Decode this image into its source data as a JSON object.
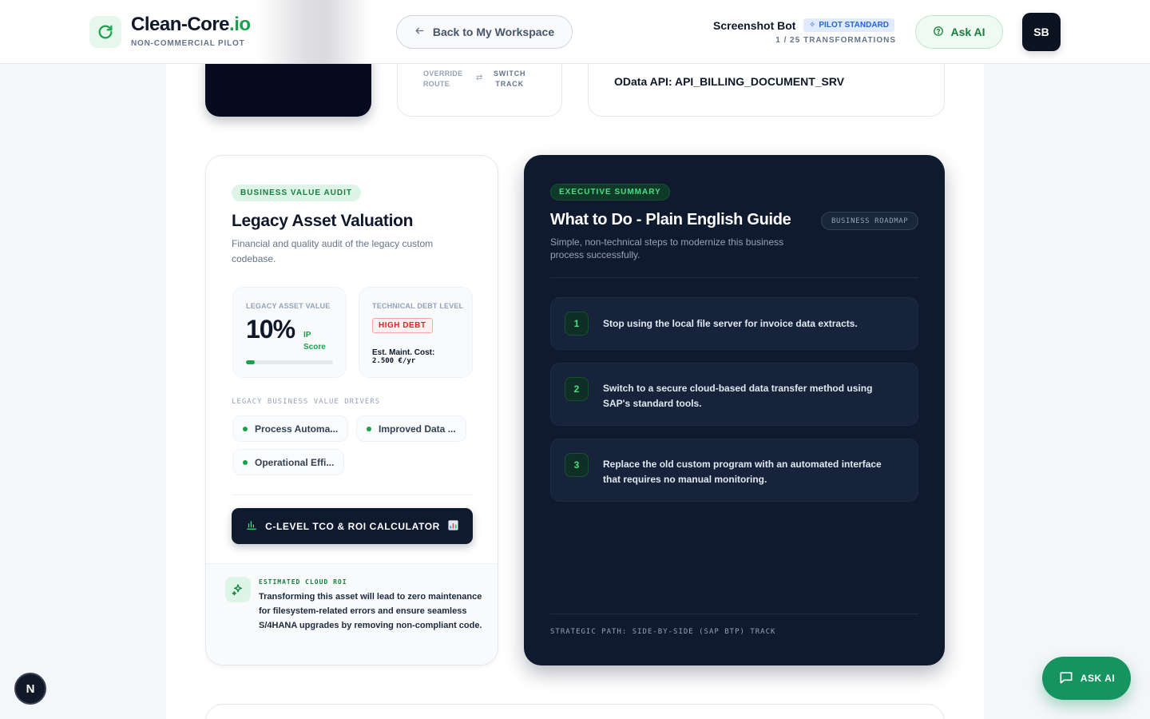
{
  "header": {
    "brand_name": "Clean-Core",
    "brand_tld": ".io",
    "brand_sub": "NON-COMMERCIAL PILOT",
    "back_label": "Back to My Workspace",
    "user_name": "Screenshot Bot",
    "plan_badge": "PILOT STANDARD",
    "transform_count": "1 / 25 TRANSFORMATIONS",
    "ask_ai_label": "Ask AI",
    "avatar_initials": "SB"
  },
  "top_cards": {
    "override_label_line1": "OVERRIDE",
    "override_label_line2": "ROUTE",
    "switch_line1": "SWITCH",
    "switch_line2": "TRACK",
    "target_value": "OData API: API_BILLING_DOCUMENT_SRV"
  },
  "valuation": {
    "tag": "BUSINESS VALUE AUDIT",
    "title": "Legacy Asset Valuation",
    "description": "Financial and quality audit of the legacy custom codebase.",
    "asset_value_label": "LEGACY ASSET VALUE",
    "asset_value": "10%",
    "ip_label": "IP",
    "score_label": "Score",
    "asset_value_fraction": 0.1,
    "debt_label": "TECHNICAL DEBT LEVEL",
    "debt_badge": "HIGH DEBT",
    "maint_label": "Est. Maint. Cost:",
    "maint_value": "2.500 €/yr",
    "drivers_label": "LEGACY BUSINESS VALUE DRIVERS",
    "drivers": [
      "Process Automa...",
      "Improved Data ...",
      "Operational Effi..."
    ],
    "roi_button": "C-LEVEL TCO & ROI CALCULATOR",
    "roi_footer_label": "ESTIMATED CLOUD ROI",
    "roi_footer_text": "Transforming this asset will lead to zero maintenance for filesystem-related errors and ensure seamless S/4HANA upgrades by removing non-compliant code."
  },
  "executive": {
    "tag": "EXECUTIVE SUMMARY",
    "title": "What to Do - Plain English Guide",
    "description": "Simple, non-technical steps to modernize this business process successfully.",
    "roadmap": "BUSINESS ROADMAP",
    "steps": [
      {
        "num": "1",
        "text": "Stop using the local file server for invoice data extracts."
      },
      {
        "num": "2",
        "text": "Switch to a secure cloud-based data transfer method using SAP's standard tools."
      },
      {
        "num": "3",
        "text": "Replace the old custom program with an automated interface that requires no manual monitoring."
      }
    ],
    "strategic_path": "STRATEGIC PATH: SIDE-BY-SIDE (SAP BTP) TRACK"
  },
  "floating": {
    "n_badge": "N",
    "fab_label": "ASK AI"
  },
  "colors": {
    "accent_green": "#16a34a",
    "navy": "#0f1a2e",
    "danger": "#dc2626"
  }
}
